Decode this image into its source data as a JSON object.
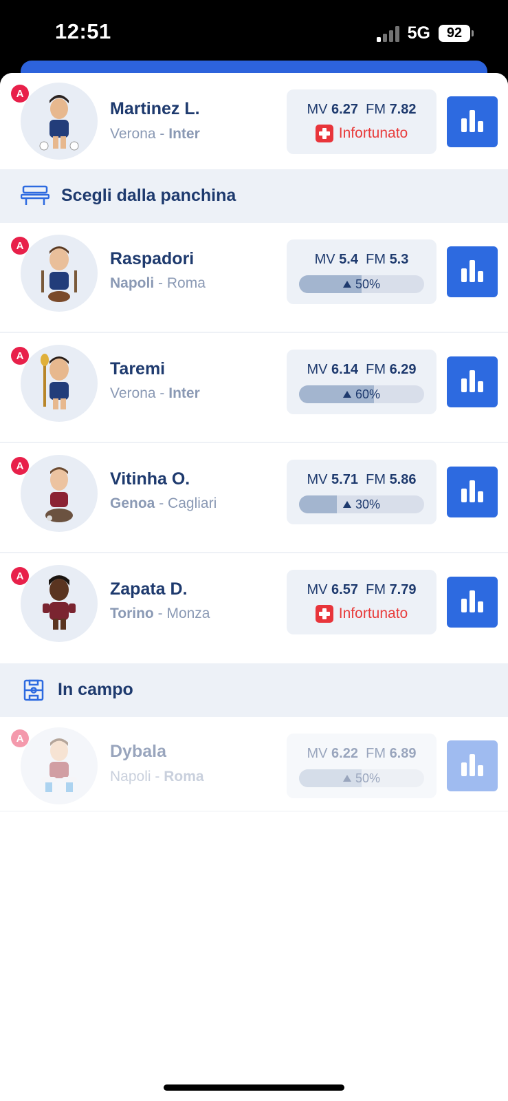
{
  "status_bar": {
    "time": "12:51",
    "network": "5G",
    "battery": "92"
  },
  "selected_player": {
    "name": "Martinez L.",
    "role": "A",
    "home": "Verona",
    "away": "Inter",
    "bold_team": "away",
    "mv": "6.27",
    "fm": "7.82",
    "status": "Infortunato"
  },
  "bench_section": {
    "title": "Scegli dalla panchina"
  },
  "bench": [
    {
      "name": "Raspadori",
      "role": "A",
      "home": "Napoli",
      "away": "Roma",
      "bold_team": "home",
      "mv": "5.4",
      "fm": "5.3",
      "probability": "50%",
      "probability_value": 50
    },
    {
      "name": "Taremi",
      "role": "A",
      "home": "Verona",
      "away": "Inter",
      "bold_team": "away",
      "mv": "6.14",
      "fm": "6.29",
      "probability": "60%",
      "probability_value": 60
    },
    {
      "name": "Vitinha O.",
      "role": "A",
      "home": "Genoa",
      "away": "Cagliari",
      "bold_team": "home",
      "mv": "5.71",
      "fm": "5.86",
      "probability": "30%",
      "probability_value": 30
    },
    {
      "name": "Zapata D.",
      "role": "A",
      "home": "Torino",
      "away": "Monza",
      "bold_team": "home",
      "mv": "6.57",
      "fm": "7.79",
      "status": "Infortunato"
    }
  ],
  "field_section": {
    "title": "In campo"
  },
  "field": [
    {
      "name": "Dybala",
      "role": "A",
      "home": "Napoli",
      "away": "Roma",
      "bold_team": "away",
      "mv": "6.22",
      "fm": "6.89",
      "probability": "50%",
      "probability_value": 50
    }
  ],
  "labels": {
    "mv": "MV",
    "fm": "FM",
    "sep": "-"
  },
  "colors": {
    "accent": "#2d6ae0",
    "navy": "#1e3a6e",
    "injury_red": "#e8353b",
    "role_badge": "#e8204a"
  }
}
